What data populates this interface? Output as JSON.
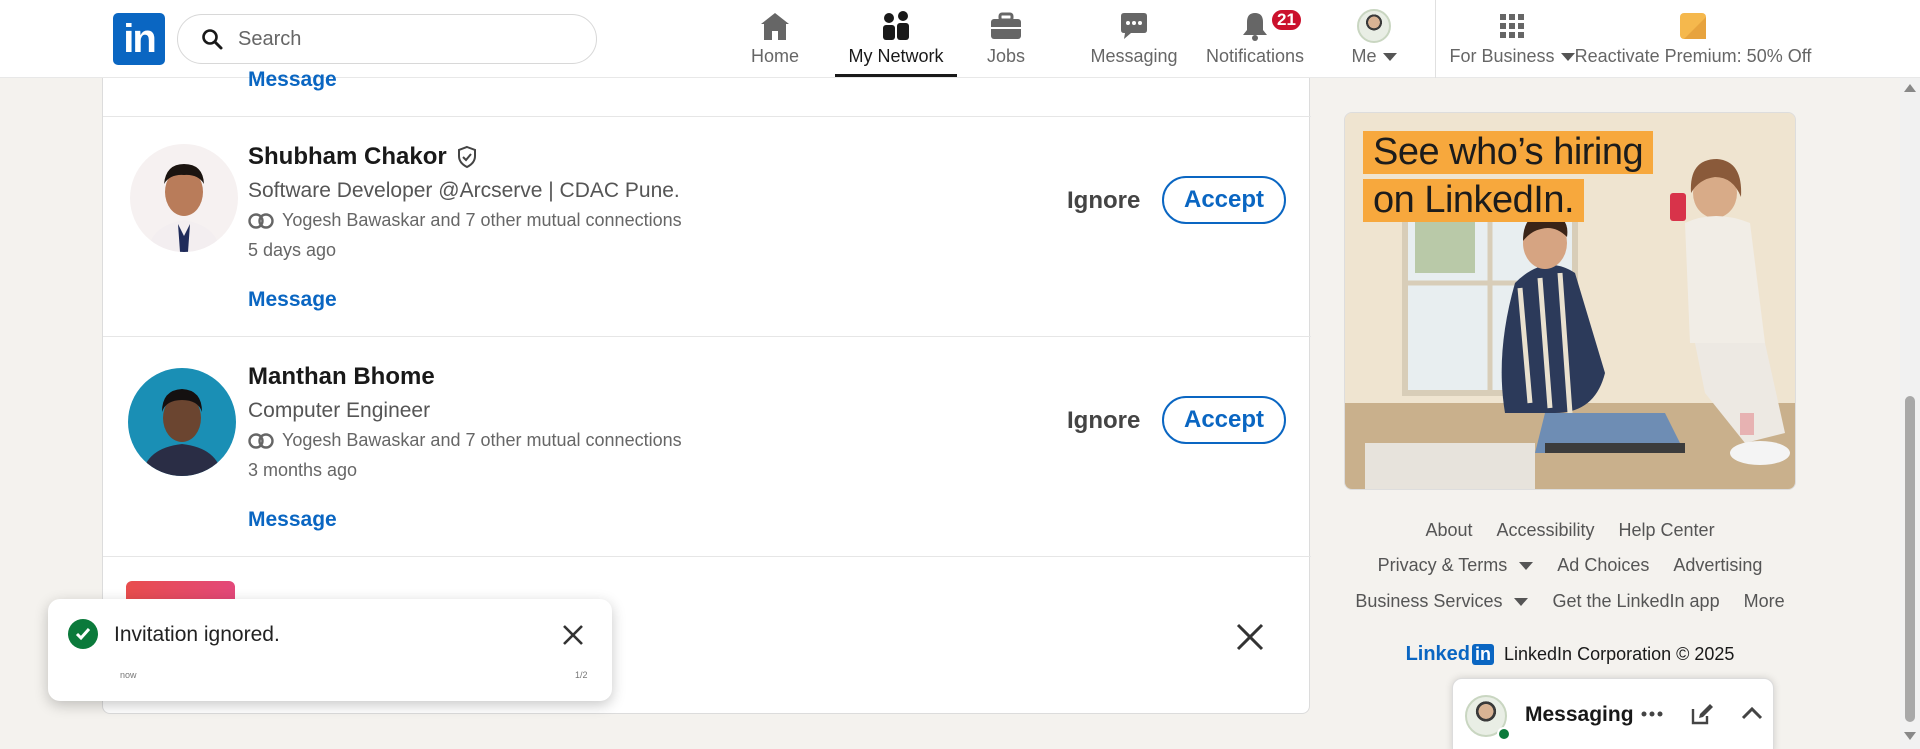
{
  "nav": {
    "logo": "in",
    "search_placeholder": "Search",
    "items": [
      {
        "label": "Home",
        "icon": "home-icon"
      },
      {
        "label": "My Network",
        "icon": "network-icon",
        "active": true
      },
      {
        "label": "Jobs",
        "icon": "briefcase-icon"
      },
      {
        "label": "Messaging",
        "icon": "messaging-icon"
      },
      {
        "label": "Notifications",
        "icon": "bell-icon",
        "badge": "21"
      },
      {
        "label": "Me",
        "icon": "avatar"
      },
      {
        "label": "For Business",
        "icon": "grid-icon"
      },
      {
        "label": "Reactivate Premium: 50% Off",
        "icon": "premium-icon"
      }
    ]
  },
  "invitations": {
    "top_message_label": "Message",
    "items": [
      {
        "name": "Shubham Chakor",
        "verified": true,
        "headline": "Software Developer @Arcserve | CDAC Pune.",
        "mutual": "Yogesh Bawaskar and 7 other mutual connections",
        "time": "5 days ago",
        "message_label": "Message",
        "ignore_label": "Ignore",
        "accept_label": "Accept"
      },
      {
        "name": "Manthan Bhome",
        "verified": false,
        "headline": "Computer Engineer",
        "mutual": "Yogesh Bawaskar and 7 other mutual connections",
        "time": "3 months ago",
        "message_label": "Message",
        "ignore_label": "Ignore",
        "accept_label": "Accept"
      }
    ]
  },
  "toast": {
    "message": "Invitation ignored.",
    "time": "now",
    "count": "1/2",
    "status_color": "#0b7a3b"
  },
  "ad": {
    "line1": "See who’s hiring",
    "line2": "on LinkedIn."
  },
  "footer": {
    "rows": [
      [
        "About",
        "Accessibility",
        "Help Center"
      ],
      [
        "Privacy & Terms",
        "Ad Choices",
        "Advertising"
      ],
      [
        "Business Services",
        "Get the LinkedIn app",
        "More"
      ]
    ],
    "logo_text": "Linked",
    "logo_in": "in",
    "copyright": "LinkedIn Corporation © 2025"
  },
  "messaging": {
    "title": "Messaging"
  },
  "colors": {
    "brand": "#0a66c2",
    "badge": "#cb112d",
    "ad_highlight": "#f7a83d"
  }
}
